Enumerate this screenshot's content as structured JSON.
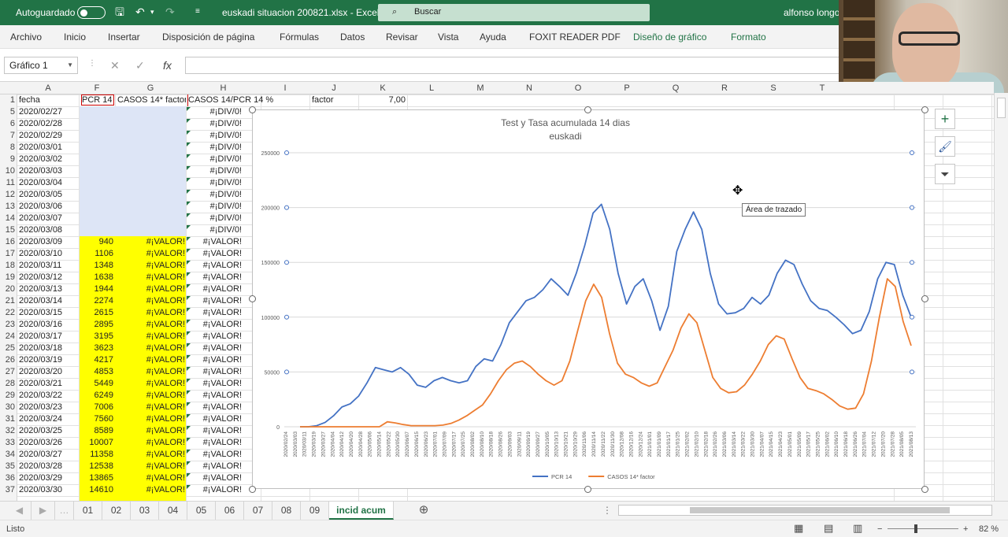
{
  "titlebar": {
    "autosave_label": "Autoguardado",
    "filename": "euskadi situacion 200821.xlsx  -  Excel",
    "search_placeholder": "Buscar",
    "user": "alfonso longo"
  },
  "menu": [
    "Archivo",
    "Inicio",
    "Insertar",
    "Disposición de página",
    "Fórmulas",
    "Datos",
    "Revisar",
    "Vista",
    "Ayuda",
    "FOXIT READER PDF",
    "Diseño de gráfico",
    "Formato"
  ],
  "formula_bar": {
    "name_box": "Gráfico 1",
    "formula": ""
  },
  "columns": [
    "A",
    "F",
    "G",
    "H",
    "I",
    "J",
    "K",
    "L",
    "M",
    "N",
    "O",
    "P",
    "Q",
    "R",
    "S",
    "T"
  ],
  "header_row": {
    "row": "1",
    "fecha": "fecha",
    "pcr": "PCR 14",
    "casos": "CASOS 14* factor",
    "ratio": "CASOS 14/PCR 14 %",
    "factor_label": "factor",
    "factor_value": "7,00"
  },
  "rows": [
    {
      "n": "5",
      "date": "2020/02/27",
      "pcr": "",
      "casos": "",
      "ratio": "#¡DIV/0!"
    },
    {
      "n": "6",
      "date": "2020/02/28",
      "pcr": "",
      "casos": "",
      "ratio": "#¡DIV/0!"
    },
    {
      "n": "7",
      "date": "2020/02/29",
      "pcr": "",
      "casos": "",
      "ratio": "#¡DIV/0!"
    },
    {
      "n": "8",
      "date": "2020/03/01",
      "pcr": "",
      "casos": "",
      "ratio": "#¡DIV/0!"
    },
    {
      "n": "9",
      "date": "2020/03/02",
      "pcr": "",
      "casos": "",
      "ratio": "#¡DIV/0!"
    },
    {
      "n": "10",
      "date": "2020/03/03",
      "pcr": "",
      "casos": "",
      "ratio": "#¡DIV/0!"
    },
    {
      "n": "11",
      "date": "2020/03/04",
      "pcr": "",
      "casos": "",
      "ratio": "#¡DIV/0!"
    },
    {
      "n": "12",
      "date": "2020/03/05",
      "pcr": "",
      "casos": "",
      "ratio": "#¡DIV/0!"
    },
    {
      "n": "13",
      "date": "2020/03/06",
      "pcr": "",
      "casos": "",
      "ratio": "#¡DIV/0!"
    },
    {
      "n": "14",
      "date": "2020/03/07",
      "pcr": "",
      "casos": "",
      "ratio": "#¡DIV/0!"
    },
    {
      "n": "15",
      "date": "2020/03/08",
      "pcr": "",
      "casos": "",
      "ratio": "#¡DIV/0!"
    },
    {
      "n": "16",
      "date": "2020/03/09",
      "pcr": "940",
      "casos": "#¡VALOR!",
      "ratio": "#¡VALOR!"
    },
    {
      "n": "17",
      "date": "2020/03/10",
      "pcr": "1106",
      "casos": "#¡VALOR!",
      "ratio": "#¡VALOR!"
    },
    {
      "n": "18",
      "date": "2020/03/11",
      "pcr": "1348",
      "casos": "#¡VALOR!",
      "ratio": "#¡VALOR!"
    },
    {
      "n": "19",
      "date": "2020/03/12",
      "pcr": "1638",
      "casos": "#¡VALOR!",
      "ratio": "#¡VALOR!"
    },
    {
      "n": "20",
      "date": "2020/03/13",
      "pcr": "1944",
      "casos": "#¡VALOR!",
      "ratio": "#¡VALOR!"
    },
    {
      "n": "21",
      "date": "2020/03/14",
      "pcr": "2274",
      "casos": "#¡VALOR!",
      "ratio": "#¡VALOR!"
    },
    {
      "n": "22",
      "date": "2020/03/15",
      "pcr": "2615",
      "casos": "#¡VALOR!",
      "ratio": "#¡VALOR!"
    },
    {
      "n": "23",
      "date": "2020/03/16",
      "pcr": "2895",
      "casos": "#¡VALOR!",
      "ratio": "#¡VALOR!"
    },
    {
      "n": "24",
      "date": "2020/03/17",
      "pcr": "3195",
      "casos": "#¡VALOR!",
      "ratio": "#¡VALOR!"
    },
    {
      "n": "25",
      "date": "2020/03/18",
      "pcr": "3623",
      "casos": "#¡VALOR!",
      "ratio": "#¡VALOR!"
    },
    {
      "n": "26",
      "date": "2020/03/19",
      "pcr": "4217",
      "casos": "#¡VALOR!",
      "ratio": "#¡VALOR!"
    },
    {
      "n": "27",
      "date": "2020/03/20",
      "pcr": "4853",
      "casos": "#¡VALOR!",
      "ratio": "#¡VALOR!"
    },
    {
      "n": "28",
      "date": "2020/03/21",
      "pcr": "5449",
      "casos": "#¡VALOR!",
      "ratio": "#¡VALOR!"
    },
    {
      "n": "29",
      "date": "2020/03/22",
      "pcr": "6249",
      "casos": "#¡VALOR!",
      "ratio": "#¡VALOR!"
    },
    {
      "n": "30",
      "date": "2020/03/23",
      "pcr": "7006",
      "casos": "#¡VALOR!",
      "ratio": "#¡VALOR!"
    },
    {
      "n": "31",
      "date": "2020/03/24",
      "pcr": "7560",
      "casos": "#¡VALOR!",
      "ratio": "#¡VALOR!"
    },
    {
      "n": "32",
      "date": "2020/03/25",
      "pcr": "8589",
      "casos": "#¡VALOR!",
      "ratio": "#¡VALOR!"
    },
    {
      "n": "33",
      "date": "2020/03/26",
      "pcr": "10007",
      "casos": "#¡VALOR!",
      "ratio": "#¡VALOR!"
    },
    {
      "n": "34",
      "date": "2020/03/27",
      "pcr": "11358",
      "casos": "#¡VALOR!",
      "ratio": "#¡VALOR!"
    },
    {
      "n": "35",
      "date": "2020/03/28",
      "pcr": "12538",
      "casos": "#¡VALOR!",
      "ratio": "#¡VALOR!"
    },
    {
      "n": "36",
      "date": "2020/03/29",
      "pcr": "13865",
      "casos": "#¡VALOR!",
      "ratio": "#¡VALOR!"
    },
    {
      "n": "37",
      "date": "2020/03/30",
      "pcr": "14610",
      "casos": "#¡VALOR!",
      "ratio": "#¡VALOR!"
    }
  ],
  "sheet_tabs": [
    "01",
    "02",
    "03",
    "04",
    "05",
    "06",
    "07",
    "08",
    "09",
    "incid acum"
  ],
  "active_tab": "incid acum",
  "status": {
    "ready": "Listo",
    "zoom": "82 %"
  },
  "tooltip": "Área de trazado",
  "chart_data": {
    "type": "line",
    "title": "Test y Tasa acumulada 14 dias",
    "subtitle": "euskadi",
    "ylim": [
      0,
      250000
    ],
    "yticks": [
      "0",
      "50000",
      "100000",
      "150000",
      "200000",
      "250000"
    ],
    "x_tick_labels": [
      "2020/02/24",
      "2020/03/03",
      "2020/03/11",
      "2020/03/19",
      "2020/03/27",
      "2020/04/04",
      "2020/04/12",
      "2020/04/20",
      "2020/04/28",
      "2020/05/06",
      "2020/05/14",
      "2020/05/22",
      "2020/05/30",
      "2020/06/07",
      "2020/06/15",
      "2020/06/23",
      "2020/07/01",
      "2020/07/09",
      "2020/07/17",
      "2020/07/25",
      "2020/08/02",
      "2020/08/10",
      "2020/08/18",
      "2020/08/26",
      "2020/09/03",
      "2020/09/11",
      "2020/09/19",
      "2020/09/27",
      "2020/10/05",
      "2020/10/13",
      "2020/10/21",
      "2020/10/29",
      "2020/11/06",
      "2020/11/14",
      "2020/11/22",
      "2020/11/30",
      "2020/12/08",
      "2020/12/16",
      "2020/12/24",
      "2021/01/01",
      "2021/01/09",
      "2021/01/17",
      "2021/01/25",
      "2021/02/02",
      "2021/02/10",
      "2021/02/18",
      "2021/02/26",
      "2021/03/06",
      "2021/03/14",
      "2021/03/22",
      "2021/03/30",
      "2021/04/07",
      "2021/04/15",
      "2021/04/23",
      "2021/05/01",
      "2021/05/09",
      "2021/05/17",
      "2021/05/25",
      "2021/06/02",
      "2021/06/10",
      "2021/06/18",
      "2021/06/26",
      "2021/07/04",
      "2021/07/12",
      "2021/07/20",
      "2021/07/28",
      "2021/08/05",
      "2021/08/13"
    ],
    "series": [
      {
        "name": "PCR 14",
        "color": "#4472c4",
        "values": [
          0,
          0,
          1000,
          4000,
          10000,
          18000,
          21000,
          28000,
          40000,
          54000,
          52000,
          50000,
          54000,
          48000,
          38000,
          36000,
          42000,
          45000,
          42000,
          40000,
          42000,
          55000,
          62000,
          60000,
          75000,
          95000,
          105000,
          115000,
          118000,
          125000,
          135000,
          128000,
          120000,
          140000,
          165000,
          195000,
          203000,
          180000,
          140000,
          112000,
          128000,
          135000,
          115000,
          88000,
          110000,
          160000,
          180000,
          196000,
          180000,
          140000,
          112000,
          103000,
          104000,
          108000,
          118000,
          112000,
          120000,
          140000,
          152000,
          148000,
          130000,
          115000,
          108000,
          106000,
          100000,
          93000,
          85000,
          88000,
          105000,
          135000,
          150000,
          148000,
          120000,
          100000
        ]
      },
      {
        "name": "CASOS 14* factor",
        "color": "#ed7d31",
        "values": [
          0,
          0,
          0,
          0,
          0,
          0,
          0,
          0,
          0,
          0,
          0,
          4500,
          3500,
          2000,
          1000,
          1000,
          1000,
          1000,
          1500,
          3000,
          6000,
          10000,
          15000,
          20000,
          30000,
          42000,
          52000,
          58000,
          60000,
          55000,
          48000,
          42000,
          38000,
          42000,
          60000,
          88000,
          115000,
          130000,
          118000,
          85000,
          58000,
          48000,
          45000,
          40000,
          37000,
          40000,
          55000,
          70000,
          90000,
          103000,
          95000,
          70000,
          45000,
          35000,
          31000,
          32000,
          38000,
          48000,
          60000,
          75000,
          83000,
          80000,
          62000,
          45000,
          35000,
          33000,
          30000,
          25000,
          19000,
          16000,
          17000,
          30000,
          60000,
          100000,
          135000,
          128000,
          96000,
          74000
        ]
      }
    ],
    "legend": "bottom"
  }
}
